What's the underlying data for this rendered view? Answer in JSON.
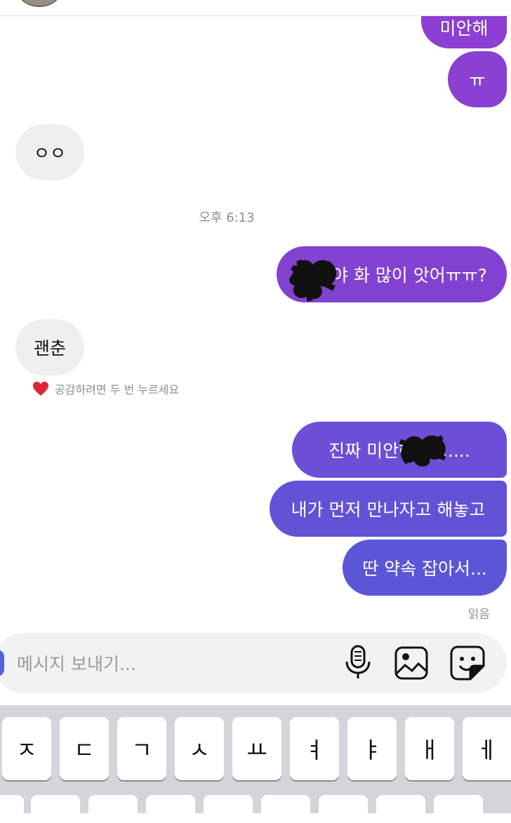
{
  "colors": {
    "outgoing_top": "#8a3fd1",
    "outgoing_bottom": "#5a5ad6",
    "incoming": "#efefef",
    "meta_text": "#8e8e8e",
    "keyboard_bg": "#d3d5db"
  },
  "messages": [
    {
      "id": "m1",
      "direction": "outgoing",
      "text": "미안해"
    },
    {
      "id": "m2",
      "direction": "outgoing",
      "text": "ㅠ"
    },
    {
      "id": "m3",
      "direction": "incoming",
      "text": "ㅇㅇ"
    },
    {
      "id": "m4",
      "direction": "outgoing",
      "text": "야 화 많이 앗어ㅠㅠ?"
    },
    {
      "id": "m5",
      "direction": "incoming",
      "text": "괜춘"
    },
    {
      "id": "m6",
      "direction": "outgoing",
      "text": "진짜 미안해 야......"
    },
    {
      "id": "m7",
      "direction": "outgoing",
      "text": "내가 먼저 만나자고 해놓고"
    },
    {
      "id": "m8",
      "direction": "outgoing",
      "text": "딴 약속 잡아서..."
    }
  ],
  "timestamp": "오후 6:13",
  "reaction_hint": {
    "icon": "heart-icon",
    "text": "공감하려면 두 번 누르세요"
  },
  "read_receipt": "읽음",
  "composer": {
    "placeholder": "메시지 보내기...",
    "icons": [
      "microphone-icon",
      "image-icon",
      "sticker-icon"
    ]
  },
  "keyboard": {
    "row1": [
      "ㅈ",
      "ㄷ",
      "ㄱ",
      "ㅅ",
      "ㅛ",
      "ㅕ",
      "ㅑ",
      "ㅐ",
      "ㅔ"
    ]
  }
}
